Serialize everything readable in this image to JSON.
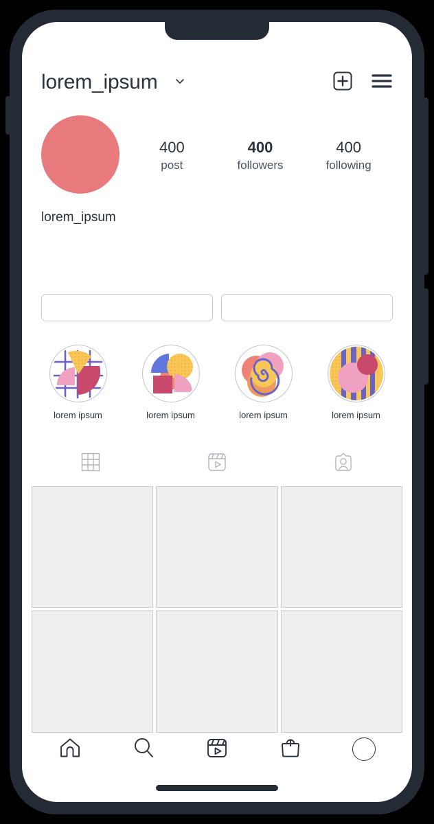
{
  "device": {
    "frame_color": "#252B34",
    "screen_bg": "#FFFFFF",
    "notch": "notch",
    "home_indicator": "home-indicator",
    "side_buttons": [
      "silence-switch",
      "volume-buttons",
      "power-button"
    ]
  },
  "header": {
    "username": "lorem_ipsum",
    "chevron_icon": "chevron-down-icon",
    "new_post_icon": "plus-square-icon",
    "menu_icon": "hamburger-menu-icon"
  },
  "profile": {
    "avatar_icon": "avatar",
    "avatar_color": "#E8797D",
    "display_name": "lorem_ipsum",
    "stats": [
      {
        "value": "400",
        "label": "post",
        "bold": false
      },
      {
        "value": "400",
        "label": "followers",
        "bold": true
      },
      {
        "value": "400",
        "label": "following",
        "bold": false
      }
    ]
  },
  "actions": {
    "primary_label": "",
    "secondary_label": ""
  },
  "highlights": [
    {
      "label": "lorem ipsum",
      "art": "grid-wedge-art"
    },
    {
      "label": "lorem ipsum",
      "art": "quarter-circles-art"
    },
    {
      "label": "lorem ipsum",
      "art": "spiral-art"
    },
    {
      "label": "lorem ipsum",
      "art": "stripes-circles-art"
    }
  ],
  "content_tabs": [
    {
      "icon": "grid-tab-icon",
      "selected": true
    },
    {
      "icon": "reels-tab-icon",
      "selected": false
    },
    {
      "icon": "tagged-tab-icon",
      "selected": false
    }
  ],
  "photo_grid": {
    "rows": 2,
    "columns": 3,
    "cell_color": "#EFEFEF",
    "cell_border": "#C6CCD4",
    "cells": [
      "",
      "",
      "",
      "",
      "",
      ""
    ]
  },
  "bottom_nav": [
    {
      "icon": "home-icon",
      "selected": true
    },
    {
      "icon": "search-icon",
      "selected": false
    },
    {
      "icon": "reels-icon",
      "selected": false
    },
    {
      "icon": "shop-bag-icon",
      "selected": false
    },
    {
      "icon": "profile-circle-icon",
      "selected": false
    }
  ],
  "palette": {
    "ink": "#2B3240",
    "muted": "#4A5160",
    "outline": "#C3C9D2",
    "art_purple": "#6B63C4",
    "art_yellow": "#F9C758",
    "art_pink": "#F0A0C0",
    "art_crimson": "#C8496B",
    "art_salmon": "#EE8275",
    "art_blue": "#6277DE",
    "art_orange": "#EE9A5E"
  }
}
